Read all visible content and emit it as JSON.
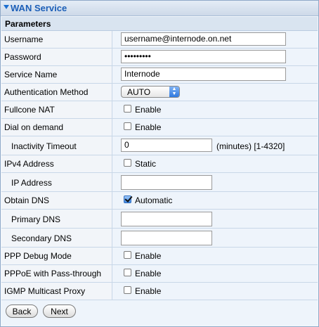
{
  "header": {
    "title": "WAN Service",
    "section": "Parameters"
  },
  "fields": {
    "username": {
      "label": "Username",
      "value": "username@internode.on.net"
    },
    "password": {
      "label": "Password",
      "value": "•••••••••"
    },
    "service_name": {
      "label": "Service Name",
      "value": "Internode"
    },
    "auth_method": {
      "label": "Authentication Method",
      "value": "AUTO"
    },
    "fullcone_nat": {
      "label": "Fullcone NAT",
      "option": "Enable",
      "checked": false
    },
    "dial_on_demand": {
      "label": "Dial on demand",
      "option": "Enable",
      "checked": false
    },
    "inactivity_timeout": {
      "label": "Inactivity Timeout",
      "value": "0",
      "suffix": "(minutes)  [1-4320]"
    },
    "ipv4_address": {
      "label": "IPv4 Address",
      "option": "Static",
      "checked": false
    },
    "ip_address": {
      "label": "IP Address",
      "value": ""
    },
    "obtain_dns": {
      "label": "Obtain DNS",
      "option": "Automatic",
      "checked": true
    },
    "primary_dns": {
      "label": "Primary DNS",
      "value": ""
    },
    "secondary_dns": {
      "label": "Secondary DNS",
      "value": ""
    },
    "ppp_debug": {
      "label": "PPP Debug Mode",
      "option": "Enable",
      "checked": false
    },
    "pppoe_passthrough": {
      "label": "PPPoE with Pass-through",
      "option": "Enable",
      "checked": false
    },
    "igmp_proxy": {
      "label": "IGMP Multicast Proxy",
      "option": "Enable",
      "checked": false
    }
  },
  "buttons": {
    "back": "Back",
    "next": "Next"
  },
  "colors": {
    "title": "#1c5fb8",
    "accent": "#2f79df"
  }
}
